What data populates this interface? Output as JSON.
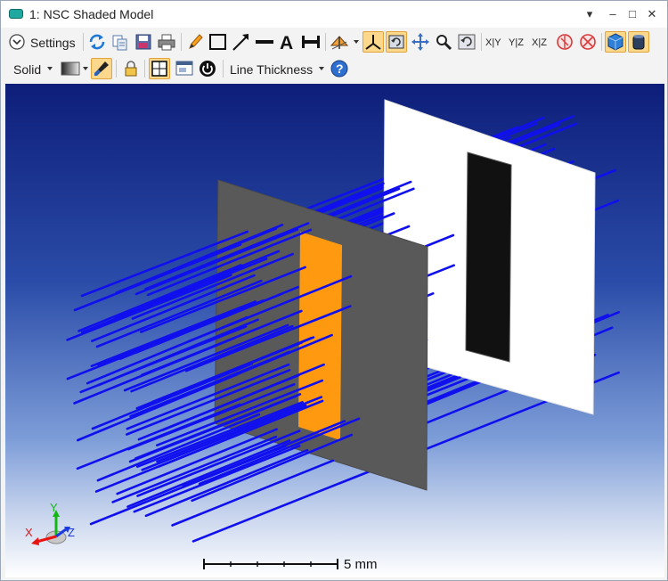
{
  "window": {
    "title": "1: NSC Shaded Model",
    "controls": [
      "▾",
      "–",
      "□",
      "✕"
    ]
  },
  "toolbar": {
    "settings_label": "Settings",
    "render_mode": "Solid",
    "line_thickness_label": "Line Thickness",
    "projection_labels": [
      "X|Y",
      "Y|Z",
      "X|Z"
    ],
    "highlight_color": "#fbd88b"
  },
  "axis_triad": {
    "x_label": "X",
    "y_label": "Y",
    "z_label": "Z"
  },
  "scale_bar": {
    "label": "5 mm"
  },
  "colors": {
    "ray": "#1010ee",
    "aperture_plate": "#555555",
    "aperture_slot": "#ff9a10",
    "detector_plate": "#ffffff",
    "detector_active": "#111111"
  }
}
